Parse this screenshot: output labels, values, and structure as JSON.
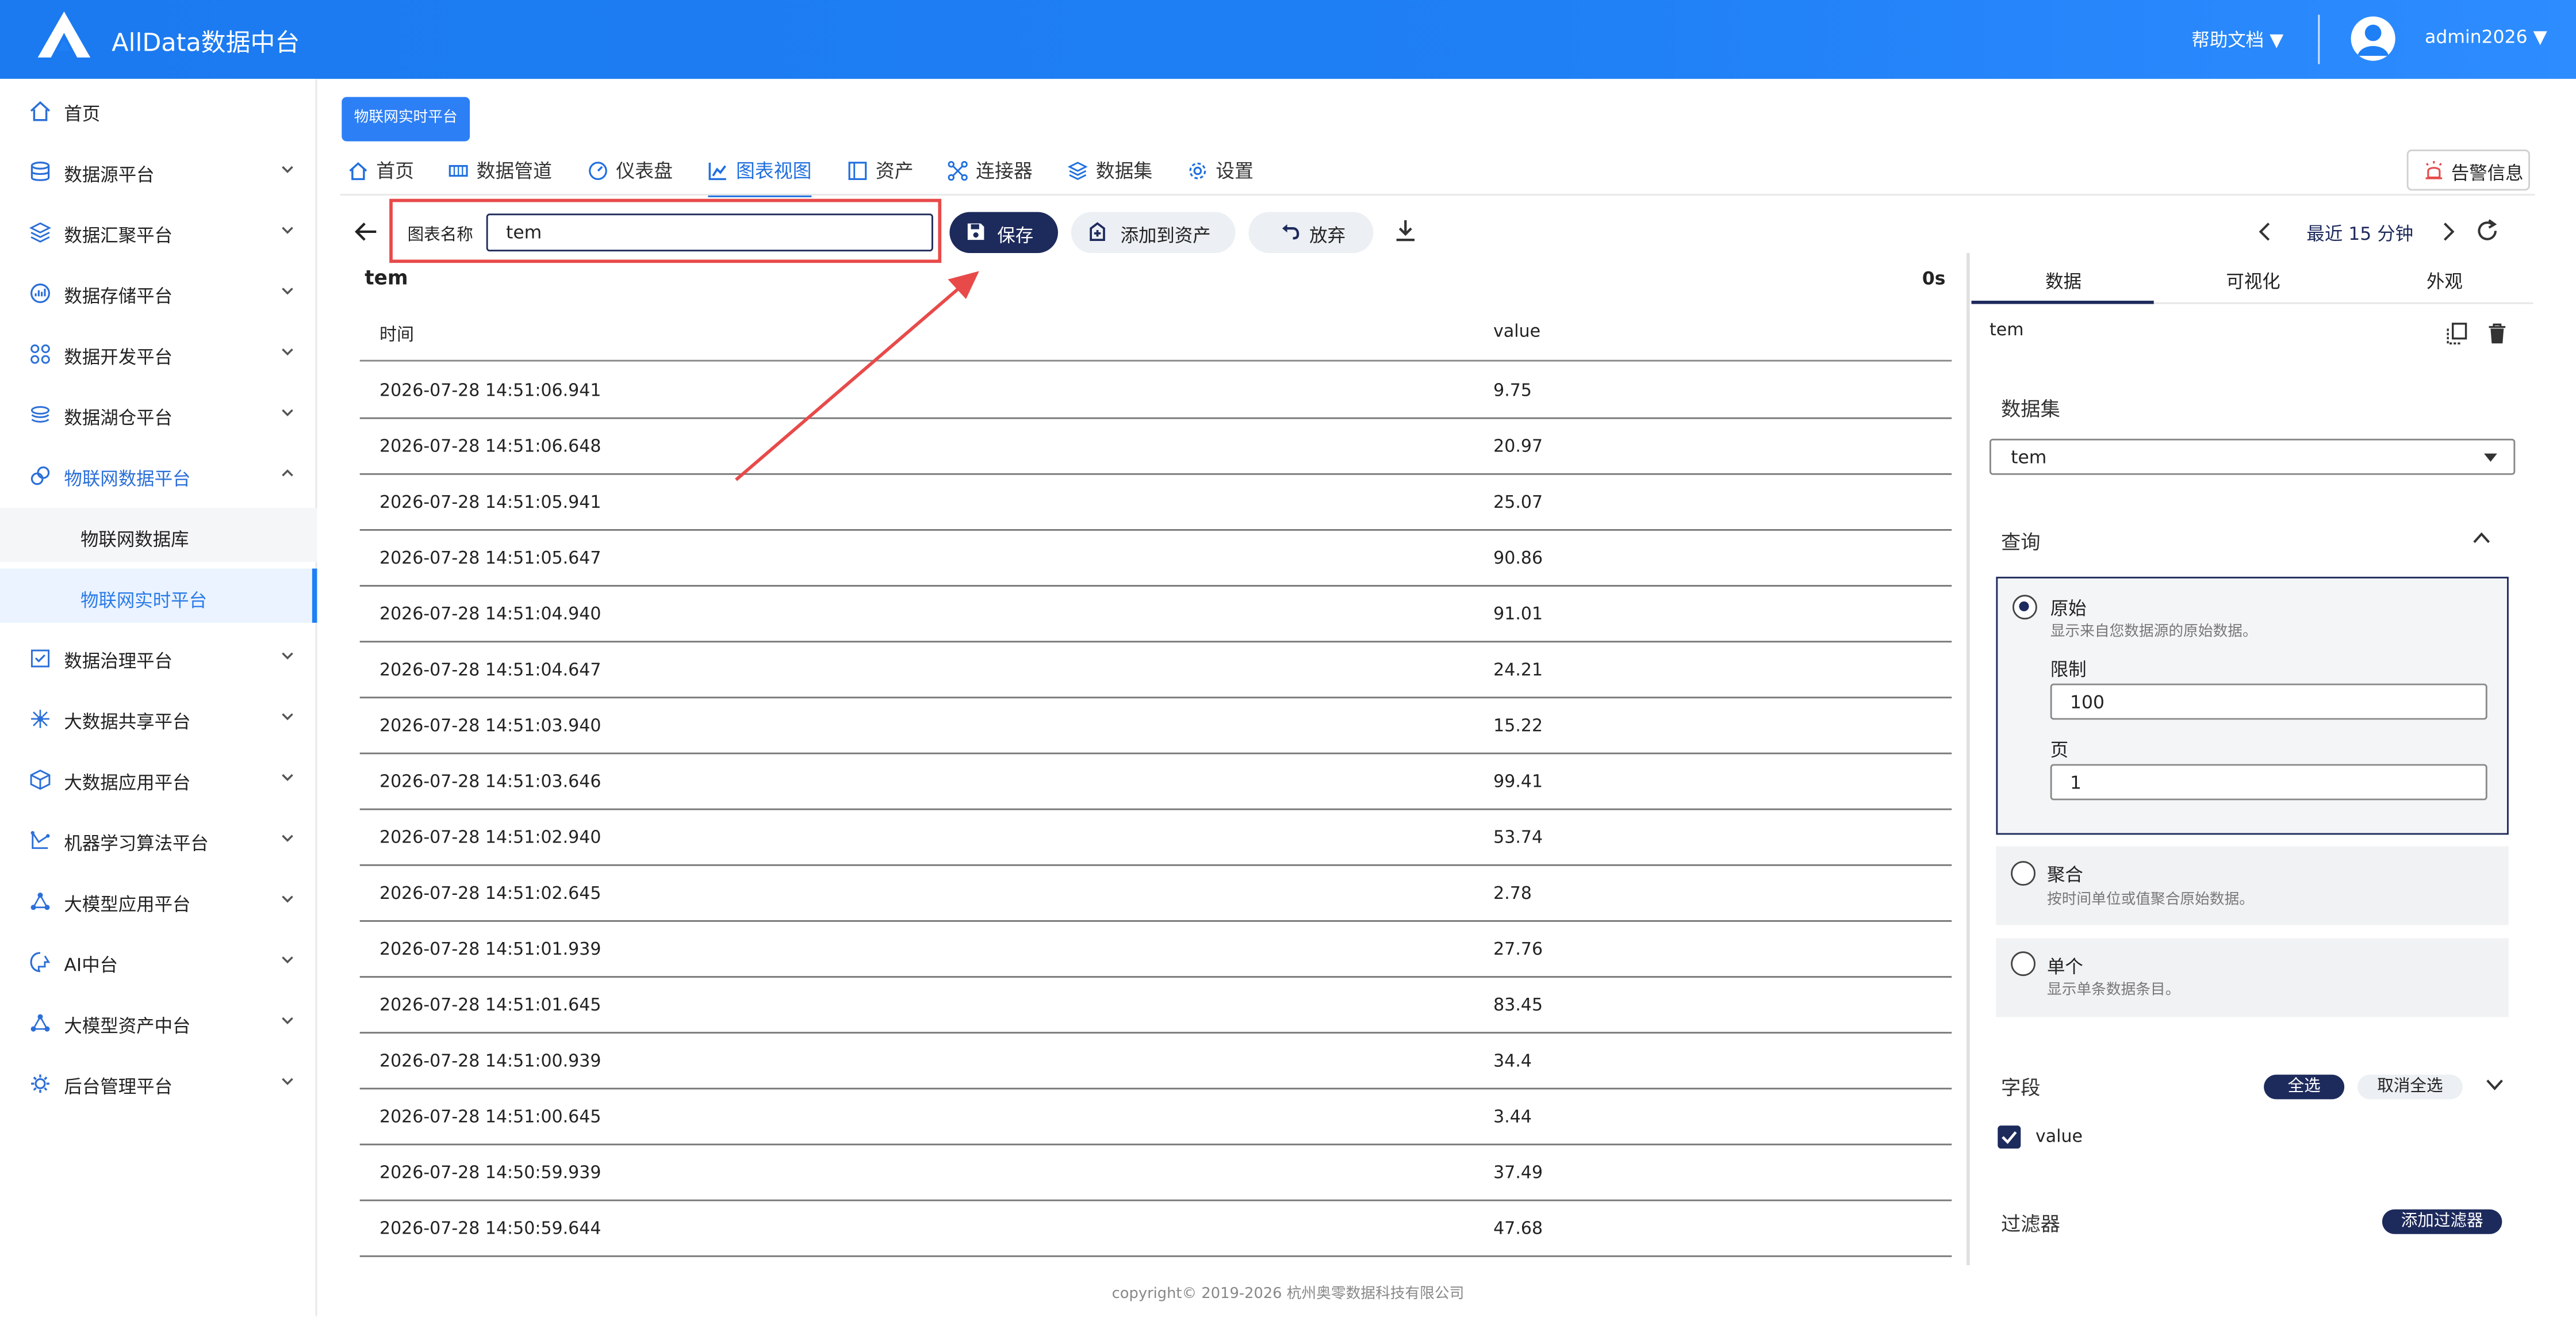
{
  "app": {
    "brand": "AllData数据中台",
    "help_label": "帮助文档 ▼",
    "user_label": "admin2026 ▼"
  },
  "sidebar": {
    "items": [
      {
        "label": "首页",
        "icon": "home-icon"
      },
      {
        "label": "数据源平台",
        "icon": "database-icon"
      },
      {
        "label": "数据汇聚平台",
        "icon": "layers-icon"
      },
      {
        "label": "数据存储平台",
        "icon": "storage-icon"
      },
      {
        "label": "数据开发平台",
        "icon": "grid-icon"
      },
      {
        "label": "数据湖仓平台",
        "icon": "lake-icon"
      },
      {
        "label": "物联网数据平台",
        "icon": "iot-icon"
      },
      {
        "label": "数据治理平台",
        "icon": "governance-icon"
      },
      {
        "label": "大数据共享平台",
        "icon": "share-icon"
      },
      {
        "label": "大数据应用平台",
        "icon": "cube-icon"
      },
      {
        "label": "机器学习算法平台",
        "icon": "ml-icon"
      },
      {
        "label": "大模型应用平台",
        "icon": "model-icon"
      },
      {
        "label": "AI中台",
        "icon": "ai-icon"
      },
      {
        "label": "大模型资产中台",
        "icon": "asset-icon"
      },
      {
        "label": "后台管理平台",
        "icon": "admin-icon"
      }
    ],
    "sub_items": [
      {
        "label": "物联网数据库"
      },
      {
        "label": "物联网实时平台"
      }
    ]
  },
  "header": {
    "platform_chip": "物联网实时平台",
    "tabs": [
      {
        "label": "首页"
      },
      {
        "label": "数据管道"
      },
      {
        "label": "仪表盘"
      },
      {
        "label": "图表视图"
      },
      {
        "label": "资产"
      },
      {
        "label": "连接器"
      },
      {
        "label": "数据集"
      },
      {
        "label": "设置"
      }
    ],
    "alert_label": "告警信息"
  },
  "toolbar": {
    "name_label": "图表名称",
    "name_value": "tem",
    "save_label": "保存",
    "add_asset_label": "添加到资产",
    "discard_label": "放弃",
    "time_range": "最近 15 分钟"
  },
  "table": {
    "title": "tem",
    "elapsed": "0s",
    "columns": [
      "时间",
      "value"
    ],
    "rows": [
      [
        "2026-07-28 14:51:06.941",
        "9.75"
      ],
      [
        "2026-07-28 14:51:06.648",
        "20.97"
      ],
      [
        "2026-07-28 14:51:05.941",
        "25.07"
      ],
      [
        "2026-07-28 14:51:05.647",
        "90.86"
      ],
      [
        "2026-07-28 14:51:04.940",
        "91.01"
      ],
      [
        "2026-07-28 14:51:04.647",
        "24.21"
      ],
      [
        "2026-07-28 14:51:03.940",
        "15.22"
      ],
      [
        "2026-07-28 14:51:03.646",
        "99.41"
      ],
      [
        "2026-07-28 14:51:02.940",
        "53.74"
      ],
      [
        "2026-07-28 14:51:02.645",
        "2.78"
      ],
      [
        "2026-07-28 14:51:01.939",
        "27.76"
      ],
      [
        "2026-07-28 14:51:01.645",
        "83.45"
      ],
      [
        "2026-07-28 14:51:00.939",
        "34.4"
      ],
      [
        "2026-07-28 14:51:00.645",
        "3.44"
      ],
      [
        "2026-07-28 14:50:59.939",
        "37.49"
      ],
      [
        "2026-07-28 14:50:59.644",
        "47.68"
      ]
    ]
  },
  "panel": {
    "tabs": [
      {
        "label": "数据"
      },
      {
        "label": "可视化"
      },
      {
        "label": "外观"
      }
    ],
    "query_name": "tem",
    "dataset_heading": "数据集",
    "dataset_value": "tem",
    "query_heading": "查询",
    "options": [
      {
        "title": "原始",
        "desc": "显示来自您数据源的原始数据。"
      },
      {
        "title": "聚合",
        "desc": "按时间单位或值聚合原始数据。"
      },
      {
        "title": "单个",
        "desc": "显示单条数据条目。"
      }
    ],
    "limit_label": "限制",
    "limit_value": "100",
    "page_label": "页",
    "page_value": "1",
    "fields_heading": "字段",
    "select_all": "全选",
    "deselect_all": "取消全选",
    "field_value": "value",
    "filters_heading": "过滤器",
    "add_filter": "添加过滤器"
  },
  "footer": {
    "text": "copyright© 2019-2026 杭州奥零数据科技有限公司"
  },
  "colors": {
    "topbar": "#1f7ff5",
    "primary_dark": "#1d2a5c",
    "highlight_red": "#e84a4a",
    "link_blue": "#2b6fd8"
  }
}
